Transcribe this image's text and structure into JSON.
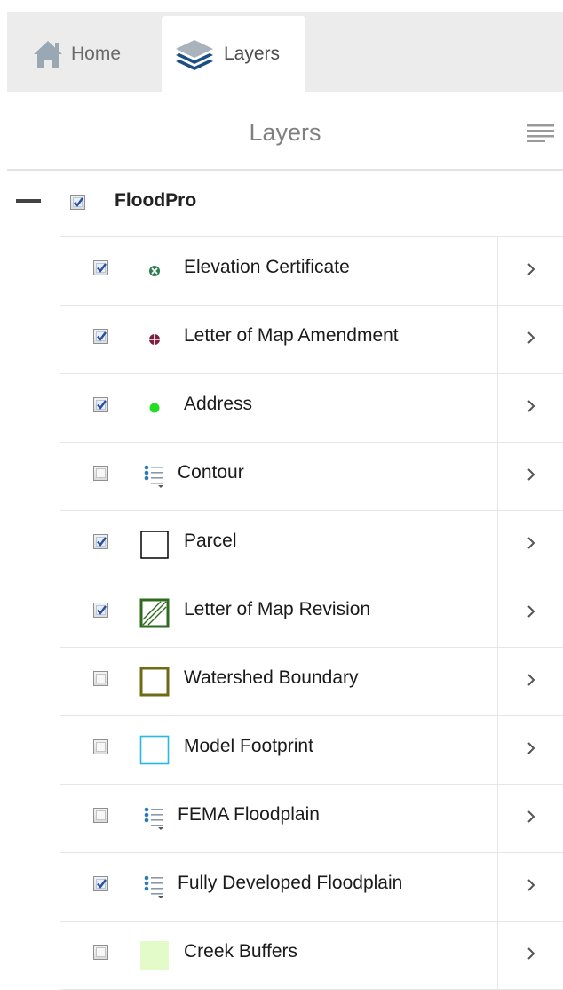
{
  "tabs": {
    "home_label": "Home",
    "layers_label": "Layers"
  },
  "panel": {
    "title": "Layers"
  },
  "group": {
    "label": "FloodPro",
    "checked": true
  },
  "layers": [
    {
      "label": "Elevation Certificate",
      "checked": true,
      "symbol": "x-circle-icon",
      "color": "#2e7d4f"
    },
    {
      "label": "Letter of Map Amendment",
      "checked": true,
      "symbol": "crosshair-circle-icon",
      "color": "#7a1f3d"
    },
    {
      "label": "Address",
      "checked": true,
      "symbol": "green-dot-icon",
      "color": "#22dd22"
    },
    {
      "label": "Contour",
      "checked": false,
      "symbol": "legend-list-icon",
      "color": "#2a7ab8"
    },
    {
      "label": "Parcel",
      "checked": true,
      "symbol": "outline-square-icon",
      "color": "#000000"
    },
    {
      "label": "Letter of Map Revision",
      "checked": true,
      "symbol": "hatched-square-icon",
      "color": "#2e6b1f"
    },
    {
      "label": "Watershed Boundary",
      "checked": false,
      "symbol": "outline-square-icon",
      "color": "#6f6a16"
    },
    {
      "label": "Model Footprint",
      "checked": false,
      "symbol": "outline-square-icon",
      "color": "#29b6e8"
    },
    {
      "label": "FEMA Floodplain",
      "checked": false,
      "symbol": "legend-list-icon",
      "color": "#2a7ab8"
    },
    {
      "label": "Fully Developed Floodplain",
      "checked": true,
      "symbol": "legend-list-icon",
      "color": "#2a7ab8"
    },
    {
      "label": "Creek Buffers",
      "checked": false,
      "symbol": "filled-square-icon",
      "color": "#e2fbc8"
    }
  ]
}
